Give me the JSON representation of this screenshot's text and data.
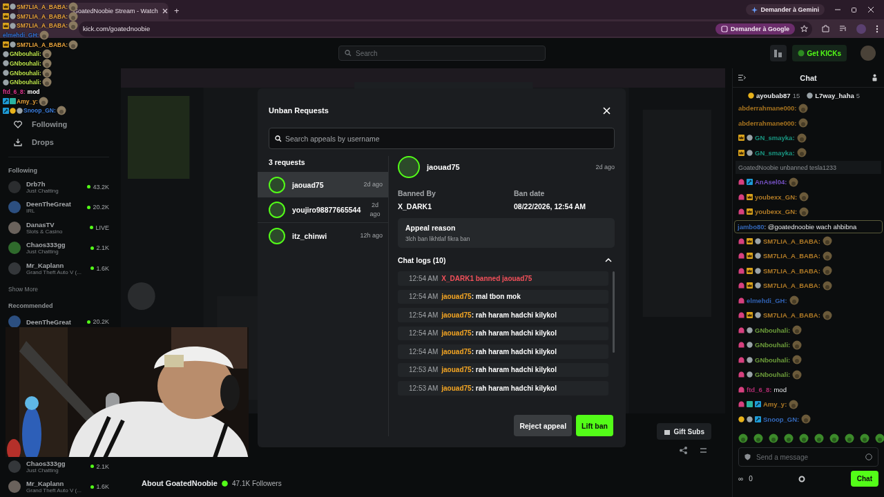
{
  "browser": {
    "tab_title": "GoatedNoobie Stream - Watch",
    "new_tab": "+",
    "gemini": "Demander à Gemini",
    "url": "kick.com/goatednoobie",
    "lens": "Demander à Google"
  },
  "overlay_chat": [
    {
      "user": "SM7LIA_A_BABA:",
      "color": "#e8a33c",
      "badges": [
        {
          "kind": "crown"
        },
        {
          "kind": "gear"
        }
      ],
      "kind": "emote"
    },
    {
      "user": "SM7LIA_A_BABA:",
      "color": "#e8a33c",
      "badges": [
        {
          "kind": "crown"
        },
        {
          "kind": "gear"
        }
      ],
      "kind": "emote"
    },
    {
      "user": "SM7LIA_A_BABA:",
      "color": "#e8a33c",
      "badges": [
        {
          "kind": "crown"
        },
        {
          "kind": "gear"
        }
      ],
      "kind": "emote"
    },
    {
      "user": "elmehdi_GH:",
      "color": "#2f6fd0",
      "kind": "emote"
    },
    {
      "user": "SM7LIA_A_BABA:",
      "color": "#e8a33c",
      "badges": [
        {
          "kind": "crown"
        },
        {
          "kind": "gear"
        }
      ],
      "kind": "emote"
    },
    {
      "user": "GNbouhali:",
      "color": "#b8e04a",
      "badges": [
        {
          "kind": "gear"
        }
      ],
      "kind": "emote"
    },
    {
      "user": "GNbouhali:",
      "color": "#b8e04a",
      "badges": [
        {
          "kind": "gear"
        }
      ],
      "kind": "emote"
    },
    {
      "user": "GNbouhali:",
      "color": "#b8e04a",
      "badges": [
        {
          "kind": "gear"
        }
      ],
      "kind": "emote"
    },
    {
      "user": "GNbouhali:",
      "color": "#b8e04a",
      "badges": [
        {
          "kind": "gear"
        }
      ],
      "kind": "emote"
    },
    {
      "user": "ftd_6_8:",
      "color": "#e0358f",
      "kind": "text",
      "text": "mod"
    },
    {
      "user": "Amy_y:",
      "color": "#e8a33c",
      "badges": [
        {
          "kind": "sword"
        },
        {
          "kind": "box"
        }
      ],
      "kind": "emote"
    },
    {
      "user": "Snoop_GN:",
      "color": "#3c7fe0",
      "badges": [
        {
          "kind": "sword"
        },
        {
          "kind": "coin"
        },
        {
          "kind": "gear"
        }
      ],
      "kind": "emote"
    }
  ],
  "header": {
    "search": {
      "placeholder": "Search"
    },
    "get_kicks": "Get KICKs"
  },
  "sidebar": {
    "nav": [
      {
        "kind": "heart",
        "label": "Following"
      },
      {
        "kind": "drops",
        "label": "Drops"
      }
    ],
    "following_title": "Following",
    "following": [
      {
        "name": "Drb7h",
        "category": "Just Chatting",
        "viewers": "43.2K"
      },
      {
        "name": "DeenTheGreat",
        "category": "IRL",
        "viewers": "20.2K"
      },
      {
        "name": "DanasTV",
        "category": "Slots & Casino",
        "viewers": "LIVE"
      },
      {
        "name": "Chaos333gg",
        "category": "Just Chatting",
        "viewers": "2.1K"
      },
      {
        "name": "Mr_Kaplann",
        "category": "Grand Theft Auto V (...",
        "viewers": "1.6K"
      }
    ],
    "show_more": "Show More",
    "recommended_title": "Recommended",
    "recommended": [
      {
        "name": "DeenTheGreat",
        "viewers": "20.2K"
      },
      {
        "name": "Chaos333gg",
        "category": "Just Chatting",
        "viewers": "2.1K"
      },
      {
        "name": "Mr_Kaplann",
        "category": "Grand Theft Auto V (...",
        "viewers": "1.6K"
      }
    ]
  },
  "stream": {
    "gift_subs": "Gift Subs",
    "about": "About GoatedNoobie",
    "followers": "47.1K Followers"
  },
  "chat": {
    "title": "Chat",
    "gifters": [
      {
        "name": "ayoubab87",
        "count": "15"
      },
      {
        "name": "L7way_haha",
        "count": "5"
      }
    ],
    "messages": [
      {
        "kind": "emote",
        "user": "abderrahmane000:",
        "color": "#a8741f"
      },
      {
        "kind": "emote",
        "user": "abderrahmane000:",
        "color": "#a8741f"
      },
      {
        "kind": "emote",
        "user": "GN_smayka:",
        "color": "#199580",
        "badges": [
          {
            "kind": "crown"
          },
          {
            "kind": "gear"
          }
        ]
      },
      {
        "kind": "emote",
        "user": "GN_smayka:",
        "color": "#199580",
        "badges": [
          {
            "kind": "crown"
          },
          {
            "kind": "gear"
          }
        ]
      },
      {
        "kind": "system",
        "text": "GoatedNoobie unbanned tesla1233"
      },
      {
        "kind": "emote",
        "user": "AnAsel04:",
        "color": "#7450c0",
        "badges": [
          {
            "kind": "sub"
          },
          {
            "kind": "sword"
          }
        ]
      },
      {
        "kind": "emote",
        "user": "youbexx_GN:",
        "color": "#b07a26",
        "badges": [
          {
            "kind": "sub"
          },
          {
            "kind": "crown"
          }
        ]
      },
      {
        "kind": "emote",
        "user": "youbexx_GN:",
        "color": "#b07a26",
        "badges": [
          {
            "kind": "sub"
          },
          {
            "kind": "crown"
          }
        ]
      },
      {
        "kind": "mention",
        "user": "jambo80",
        "color": "#3468b8",
        "text": ": @goatednoobie wach ahbibna"
      },
      {
        "kind": "emote",
        "user": "SM7LIA_A_BABA:",
        "color": "#b07a26",
        "badges": [
          {
            "kind": "sub"
          },
          {
            "kind": "crown"
          },
          {
            "kind": "gear"
          }
        ]
      },
      {
        "kind": "emote",
        "user": "SM7LIA_A_BABA:",
        "color": "#b07a26",
        "badges": [
          {
            "kind": "sub"
          },
          {
            "kind": "crown"
          },
          {
            "kind": "gear"
          }
        ]
      },
      {
        "kind": "emote",
        "user": "SM7LIA_A_BABA:",
        "color": "#b07a26",
        "badges": [
          {
            "kind": "sub"
          },
          {
            "kind": "crown"
          },
          {
            "kind": "gear"
          }
        ]
      },
      {
        "kind": "emote",
        "user": "SM7LIA_A_BABA:",
        "color": "#b07a26",
        "badges": [
          {
            "kind": "sub"
          },
          {
            "kind": "crown"
          },
          {
            "kind": "gear"
          }
        ]
      },
      {
        "kind": "emote",
        "user": "elmehdi_GH:",
        "color": "#3060b0",
        "badges": [
          {
            "kind": "sub"
          }
        ]
      },
      {
        "kind": "emote",
        "user": "SM7LIA_A_BABA:",
        "color": "#b07a26",
        "badges": [
          {
            "kind": "sub"
          },
          {
            "kind": "crown"
          },
          {
            "kind": "gear"
          }
        ]
      },
      {
        "kind": "emote",
        "user": "GNbouhali:",
        "color": "#6c9c3a",
        "badges": [
          {
            "kind": "sub"
          },
          {
            "kind": "gear"
          }
        ]
      },
      {
        "kind": "emote",
        "user": "GNbouhali:",
        "color": "#6c9c3a",
        "badges": [
          {
            "kind": "sub"
          },
          {
            "kind": "gear"
          }
        ]
      },
      {
        "kind": "emote",
        "user": "GNbouhali:",
        "color": "#6c9c3a",
        "badges": [
          {
            "kind": "sub"
          },
          {
            "kind": "gear"
          }
        ]
      },
      {
        "kind": "emote",
        "user": "GNbouhali:",
        "color": "#6c9c3a",
        "badges": [
          {
            "kind": "sub"
          },
          {
            "kind": "gear"
          }
        ]
      },
      {
        "kind": "text",
        "user": "ftd_6_8:",
        "color": "#b02c70",
        "badges": [
          {
            "kind": "sub"
          }
        ],
        "text": "mod"
      },
      {
        "kind": "emote",
        "user": "Amy_y:",
        "color": "#b07a26",
        "badges": [
          {
            "kind": "sub"
          },
          {
            "kind": "box"
          },
          {
            "kind": "sword"
          }
        ]
      },
      {
        "kind": "emote",
        "user": "Snoop_GN:",
        "color": "#3468b8",
        "badges": [
          {
            "kind": "coin"
          },
          {
            "kind": "gear"
          },
          {
            "kind": "sword"
          }
        ]
      }
    ],
    "input": {
      "placeholder": "Send a message"
    },
    "infinity": "∞",
    "kicks": "0",
    "send": "Chat"
  },
  "modal": {
    "title": "Unban Requests",
    "search": {
      "placeholder": "Search appeals by username"
    },
    "count": "3 requests",
    "requests": [
      {
        "name": "jaouad75",
        "time": "2d ago",
        "selected": true
      },
      {
        "name": "youjiro98877665544",
        "time": "2d ago",
        "selected": false
      },
      {
        "name": "itz_chinwi",
        "time": "12h ago",
        "selected": false
      }
    ],
    "detail": {
      "name": "jaouad75",
      "time": "2d ago",
      "banned_by_label": "Banned By",
      "banned_by": "X_DARK1",
      "ban_date_label": "Ban date",
      "ban_date": "08/22/2026, 12:54 AM",
      "reason_label": "Appeal reason",
      "reason": "3lch ban likhtlaf fikra ban"
    },
    "logs_title": "Chat logs (10)",
    "logs_expanded": true,
    "logs": [
      {
        "kind": "ban",
        "time": "12:54 AM",
        "text": "X_DARK1 banned jaouad75"
      },
      {
        "kind": "message",
        "time": "12:54 AM",
        "user": "jaouad75",
        "text": ": mal tbon mok"
      },
      {
        "kind": "message",
        "time": "12:54 AM",
        "user": "jaouad75",
        "text": ": rah haram hadchi kilykol"
      },
      {
        "kind": "message",
        "time": "12:54 AM",
        "user": "jaouad75",
        "text": ": rah haram hadchi kilykol"
      },
      {
        "kind": "message",
        "time": "12:54 AM",
        "user": "jaouad75",
        "text": ": rah haram hadchi kilykol"
      },
      {
        "kind": "message",
        "time": "12:53 AM",
        "user": "jaouad75",
        "text": ": rah haram hadchi kilykol"
      },
      {
        "kind": "message",
        "time": "12:53 AM",
        "user": "jaouad75",
        "text": ": rah haram hadchi kilykol"
      }
    ],
    "reject": "Reject appeal",
    "lift": "Lift ban"
  }
}
